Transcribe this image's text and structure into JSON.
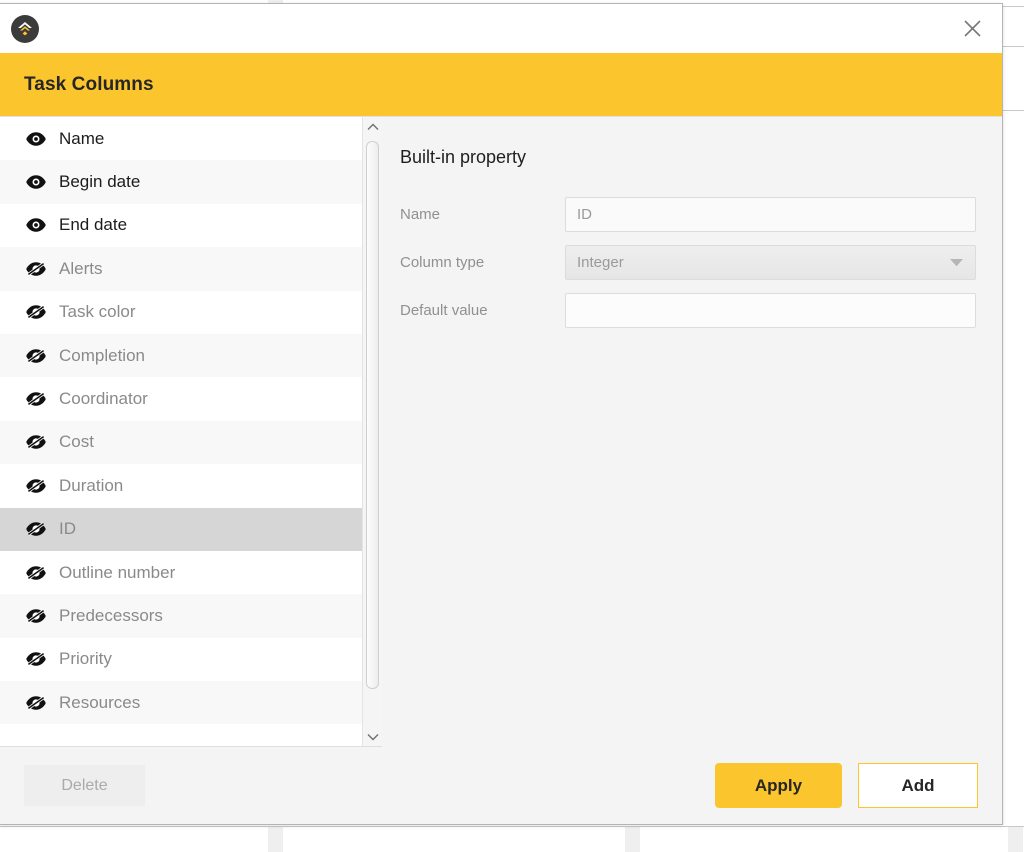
{
  "background": {
    "description": "application window behind modal"
  },
  "dialog": {
    "app_icon_name": "app-logo-icon",
    "close_icon": "close-icon",
    "title": "Task Columns"
  },
  "columns_list": {
    "visible_icon_name": "eye-visible-icon",
    "hidden_icon_name": "eye-hidden-icon",
    "items": [
      {
        "label": "Name",
        "visible": true,
        "selected": false
      },
      {
        "label": "Begin date",
        "visible": true,
        "selected": false
      },
      {
        "label": "End date",
        "visible": true,
        "selected": false
      },
      {
        "label": "Alerts",
        "visible": false,
        "selected": false
      },
      {
        "label": "Task color",
        "visible": false,
        "selected": false
      },
      {
        "label": "Completion",
        "visible": false,
        "selected": false
      },
      {
        "label": "Coordinator",
        "visible": false,
        "selected": false
      },
      {
        "label": "Cost",
        "visible": false,
        "selected": false
      },
      {
        "label": "Duration",
        "visible": false,
        "selected": false
      },
      {
        "label": "ID",
        "visible": false,
        "selected": true
      },
      {
        "label": "Outline number",
        "visible": false,
        "selected": false
      },
      {
        "label": "Predecessors",
        "visible": false,
        "selected": false
      },
      {
        "label": "Priority",
        "visible": false,
        "selected": false
      },
      {
        "label": "Resources",
        "visible": false,
        "selected": false
      }
    ],
    "scrollbar": {
      "up_icon": "chevron-up-icon",
      "down_icon": "chevron-down-icon"
    }
  },
  "detail": {
    "heading": "Built-in property",
    "name_label": "Name",
    "name_value": "ID",
    "column_type_label": "Column type",
    "column_type_value": "Integer",
    "column_type_arrow_icon": "chevron-down-icon",
    "default_value_label": "Default value",
    "default_value": ""
  },
  "footer": {
    "delete_label": "Delete",
    "apply_label": "Apply",
    "add_label": "Add"
  },
  "colors": {
    "accent_yellow": "#fbc52d",
    "selected_row": "#d6d6d6",
    "panel_bg": "#f4f4f4",
    "text_dark": "#1c1c1c",
    "text_muted": "#8a8a8a"
  }
}
